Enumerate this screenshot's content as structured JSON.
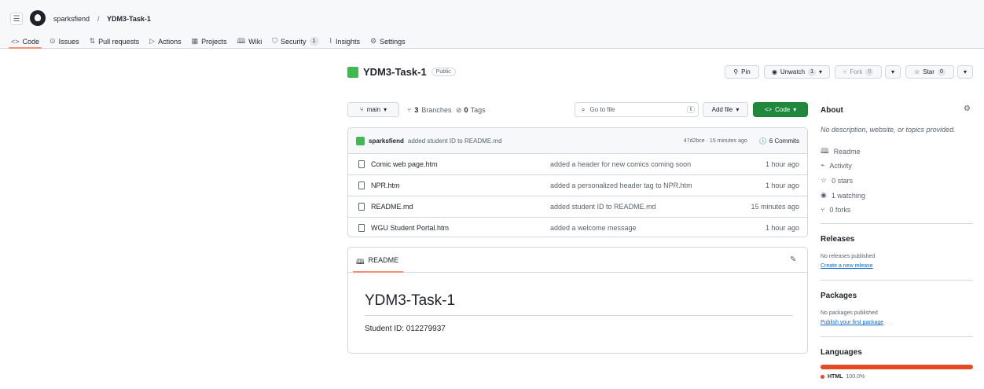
{
  "breadcrumb": {
    "owner": "sparksfiend",
    "sep": "/",
    "repo": "YDM3-Task-1"
  },
  "nav": [
    {
      "icon": "<>",
      "label": "Code",
      "active": true
    },
    {
      "icon": "⊙",
      "label": "Issues"
    },
    {
      "icon": "⇅",
      "label": "Pull requests"
    },
    {
      "icon": "▷",
      "label": "Actions"
    },
    {
      "icon": "▦",
      "label": "Projects"
    },
    {
      "icon": "🕮",
      "label": "Wiki"
    },
    {
      "icon": "⛉",
      "label": "Security",
      "count": "1"
    },
    {
      "icon": "⌇",
      "label": "Insights"
    },
    {
      "icon": "⚙",
      "label": "Settings"
    }
  ],
  "repo": {
    "name": "YDM3-Task-1",
    "visibility": "Public"
  },
  "actions": {
    "pin": "Pin",
    "unwatch": "Unwatch",
    "unwatch_count": "1",
    "fork": "Fork",
    "fork_count": "0",
    "star": "Star",
    "star_count": "0"
  },
  "toolbar": {
    "branch": "main",
    "branches_count": "3",
    "branches_label": "Branches",
    "tags_count": "0",
    "tags_label": "Tags",
    "search_placeholder": "Go to file",
    "search_key": "t",
    "add_file": "Add file",
    "code": "Code"
  },
  "commit": {
    "author": "sparksfiend",
    "message": "added student ID to README.md",
    "hash_time": "47d2bce · 15 minutes ago",
    "commits": "6 Commits"
  },
  "files": [
    {
      "name": "Comic web page.htm",
      "message": "added a header for new comics coming soon",
      "time": "1 hour ago"
    },
    {
      "name": "NPR.htm",
      "message": "added a personalized header tag to NPR.htm",
      "time": "1 hour ago"
    },
    {
      "name": "README.md",
      "message": "added student ID to README.md",
      "time": "15 minutes ago"
    },
    {
      "name": "WGU Student Portal.htm",
      "message": "added a welcome message",
      "time": "1 hour ago"
    }
  ],
  "readme": {
    "tab": "README",
    "heading": "YDM3-Task-1",
    "body": "Student ID: 012279937"
  },
  "about": {
    "title": "About",
    "description": "No description, website, or topics provided.",
    "items": [
      {
        "icon": "book-icon",
        "glyph": "🕮",
        "label": "Readme"
      },
      {
        "icon": "pulse-icon",
        "glyph": "⌁",
        "label": "Activity"
      },
      {
        "icon": "star-icon",
        "glyph": "☆",
        "label": "0 stars"
      },
      {
        "icon": "eye-icon",
        "glyph": "◉",
        "label": "1 watching"
      },
      {
        "icon": "fork-icon",
        "glyph": "⑂",
        "label": "0 forks"
      }
    ]
  },
  "releases": {
    "title": "Releases",
    "none": "No releases published",
    "create": "Create a new release"
  },
  "packages": {
    "title": "Packages",
    "none": "No packages published",
    "publish": "Publish your first package"
  },
  "languages": {
    "title": "Languages",
    "items": [
      {
        "name": "HTML",
        "percent": "100.0%",
        "color": "#e34c26",
        "share": 1.0
      }
    ]
  }
}
